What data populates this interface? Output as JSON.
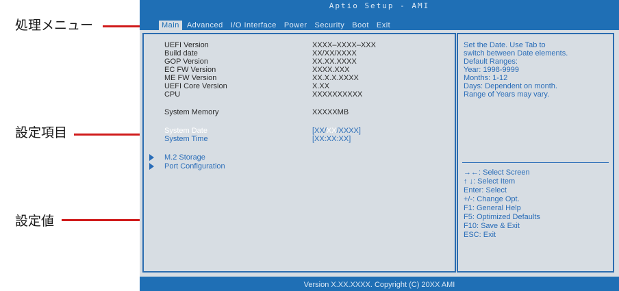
{
  "annotations": {
    "menu": "処理メニュー",
    "item": "設定項目",
    "value": "設定値"
  },
  "bios": {
    "title": "Aptio Setup - AMI",
    "tabs": [
      "Main",
      "Advanced",
      "I/O Interface",
      "Power",
      "Security",
      "Boot",
      "Exit"
    ],
    "info": [
      {
        "label": "UEFI Version",
        "value": "XXXX–XXXX–XXX"
      },
      {
        "label": "Build date",
        "value": "XX/XX/XXXX"
      },
      {
        "label": "GOP Version",
        "value": "XX.XX.XXXX"
      },
      {
        "label": "EC FW Version",
        "value": "XXXX.XXX"
      },
      {
        "label": "ME FW Version",
        "value": "XX.X.X.XXXX"
      },
      {
        "label": "UEFI Core Version",
        "value": "X.XX"
      },
      {
        "label": "CPU",
        "value": "XXXXXXXXXX"
      }
    ],
    "memory": {
      "label": "System Memory",
      "value": "XXXXXMB"
    },
    "date": {
      "label": "System Date",
      "open": "[XX/",
      "mid": "XX",
      "close": "/XXXX]"
    },
    "time": {
      "label": "System Time",
      "value": "[XX:XX:XX]"
    },
    "submenus": [
      "M.2 Storage",
      "Port Configuration"
    ],
    "help": [
      "Set the Date. Use Tab to",
      "switch between Date elements.",
      "Default Ranges:",
      "Year: 1998-9999",
      "Months: 1-12",
      "Days: Dependent on month.",
      "Range of Years may vary."
    ],
    "keys": [
      "→←: Select Screen",
      "↑ ↓: Select Item",
      "Enter: Select",
      "+/-: Change Opt.",
      "F1: General Help",
      "F5: Optimized Defaults",
      "F10: Save & Exit",
      "ESC: Exit"
    ],
    "footer": "Version X.XX.XXXX. Copyright (C) 20XX AMI"
  },
  "colors": {
    "bios_blue": "#1f6fb5",
    "panel_gray": "#d7dde3",
    "accent_text": "#2a6db8",
    "annotation_red": "#d01a1a"
  }
}
